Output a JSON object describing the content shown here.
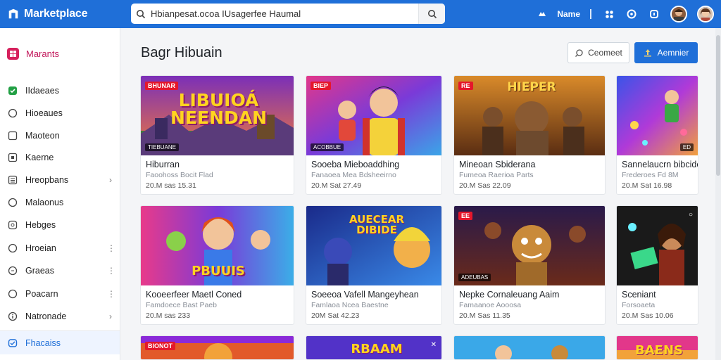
{
  "app": {
    "title": "Marketplace",
    "search_value": "Hbianpesat.ocoa IUsagerfee Haumal",
    "user_name": "Name"
  },
  "colors": {
    "accent": "#1f6fd8",
    "brand_pink": "#d6205c",
    "badge_red": "#e5172b"
  },
  "sidebar": {
    "top": {
      "label": "Marants",
      "icon": "grid-icon"
    },
    "items": [
      {
        "label": "IIdaeaes",
        "icon": "check-square-icon",
        "trail": ""
      },
      {
        "label": "Hioeaues",
        "icon": "circle-icon",
        "trail": ""
      },
      {
        "label": "Maoteon",
        "icon": "square-icon",
        "trail": ""
      },
      {
        "label": "Kaerne",
        "icon": "square-icon",
        "trail": ""
      },
      {
        "label": "Hreopbans",
        "icon": "list-icon",
        "trail": "›"
      },
      {
        "label": "Malaonus",
        "icon": "circle-icon",
        "trail": ""
      },
      {
        "label": "Hebges",
        "icon": "square-icon",
        "trail": ""
      },
      {
        "label": "Hroeian",
        "icon": "circle-icon",
        "trail": "⋮"
      },
      {
        "label": "Graeas",
        "icon": "circle-icon",
        "trail": "⋮"
      },
      {
        "label": "Poacarn",
        "icon": "circle-icon",
        "trail": "⋮"
      },
      {
        "label": "Natronade",
        "icon": "info-icon",
        "trail": "›"
      }
    ],
    "active": {
      "label": "Fhacaiss",
      "icon": "shield-icon"
    }
  },
  "main": {
    "title": "Bagr Hibuain",
    "comment_label": "Ceomeet",
    "primary_label": "Aemnier"
  },
  "cards": [
    {
      "art": "LIBUIOÁ NEENDAN",
      "badge": "BHUNAR",
      "tag": "TIEBUANE",
      "corner": "",
      "title": "Hiburran",
      "sub": "Faoohoss Bocit Flad",
      "meta": "20.M sas 15.31"
    },
    {
      "art": "",
      "badge": "BIEP",
      "tag": "ACOBBUE",
      "corner": "",
      "title": "Sooeba Mieboaddhing",
      "sub": "Fanaoea Mea Bdsheeirno",
      "meta": "20.M Sat 27.49"
    },
    {
      "art": "HIEPER",
      "badge": "RE",
      "tag": "",
      "corner": "",
      "title": "Mineoan Sbiderana",
      "sub": "Fumeoa Raerioa Parts",
      "meta": "20.M Sas 22.09"
    },
    {
      "art": "",
      "badge": "",
      "tag": "ED",
      "corner": "",
      "title": "Sannelaucrn bibcide",
      "sub": "Frederoes Fd 8M",
      "meta": "20.M Sat 16.98"
    },
    {
      "art": "PBUUIS",
      "badge": "",
      "tag": "",
      "corner": "",
      "title": "Kooeerfeer Maetl Coned",
      "sub": "Famdoece Bast Paeb",
      "meta": "20.M sas 233"
    },
    {
      "art": "AUECEAR DIBIDE",
      "badge": "",
      "tag": "",
      "corner": "",
      "title": "Soeeoa Vafell Mangeyhean",
      "sub": "Famlaoa Ncea Baestne",
      "meta": "20M Sat 42.23"
    },
    {
      "art": "",
      "badge": "EE",
      "tag": "ADEUBAS",
      "corner": "",
      "title": "Nepke Cornaleuang Aaim",
      "sub": "Famaanoe Aooosa",
      "meta": "20.M Sas 11.35"
    },
    {
      "art": "",
      "badge": "",
      "tag": "",
      "corner": "○",
      "title": "Sceniant",
      "sub": "Forsoaeta",
      "meta": "20.M Sas 10.06"
    },
    {
      "art": "",
      "badge": "BIONOT",
      "tag": "",
      "corner": "",
      "title": "",
      "sub": "",
      "meta": ""
    },
    {
      "art": "RBAAM",
      "badge": "",
      "tag": "",
      "corner": "✕",
      "title": "",
      "sub": "",
      "meta": ""
    },
    {
      "art": "",
      "badge": "",
      "tag": "",
      "corner": "",
      "title": "",
      "sub": "",
      "meta": ""
    },
    {
      "art": "BAENS",
      "badge": "",
      "tag": "",
      "corner": "",
      "title": "",
      "sub": "",
      "meta": ""
    }
  ]
}
